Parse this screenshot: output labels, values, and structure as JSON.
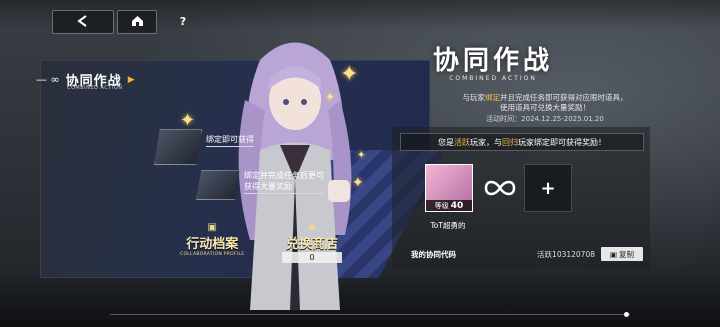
{
  "nav": {
    "back_icon": "back-arrow-icon",
    "home_icon": "home-icon",
    "help_icon": "question-icon"
  },
  "banner": {
    "title": "协同作战",
    "subtitle": "COMBINED ACTION",
    "rewards": [
      {
        "label": "绑定即可获得"
      },
      {
        "label": "绑定并完成任务后更可\n获得大量奖励"
      }
    ],
    "tabs": [
      {
        "title": "行动档案",
        "subtitle": "COLLABORATION PROFILE"
      },
      {
        "title": "兑换商店",
        "count": "0"
      }
    ]
  },
  "event": {
    "logo_cn": "协同作战",
    "logo_en": "COMBINED ACTION",
    "desc_pre": "与玩家",
    "desc_hl": "绑定",
    "desc_post": "并且完成任务即可获得对应限时道具，",
    "desc_line2": "使用道具可兑换大量奖励！",
    "date": "活动时间：2024.12.25-2025.01.20"
  },
  "role": {
    "p1": "您是",
    "hl1": "活跃",
    "p2": "玩家，与",
    "hl2": "回归",
    "p3": "玩家绑定即可获得奖励！"
  },
  "player": {
    "level_label": "等级",
    "level": "40",
    "name": "ToT超勇的"
  },
  "partner_slot": "+",
  "code": {
    "label": "我的协同代码",
    "value": "活跃103120708",
    "copy_label": "复制"
  },
  "colors": {
    "accent": "#f6c245",
    "panel": "#26304c"
  }
}
